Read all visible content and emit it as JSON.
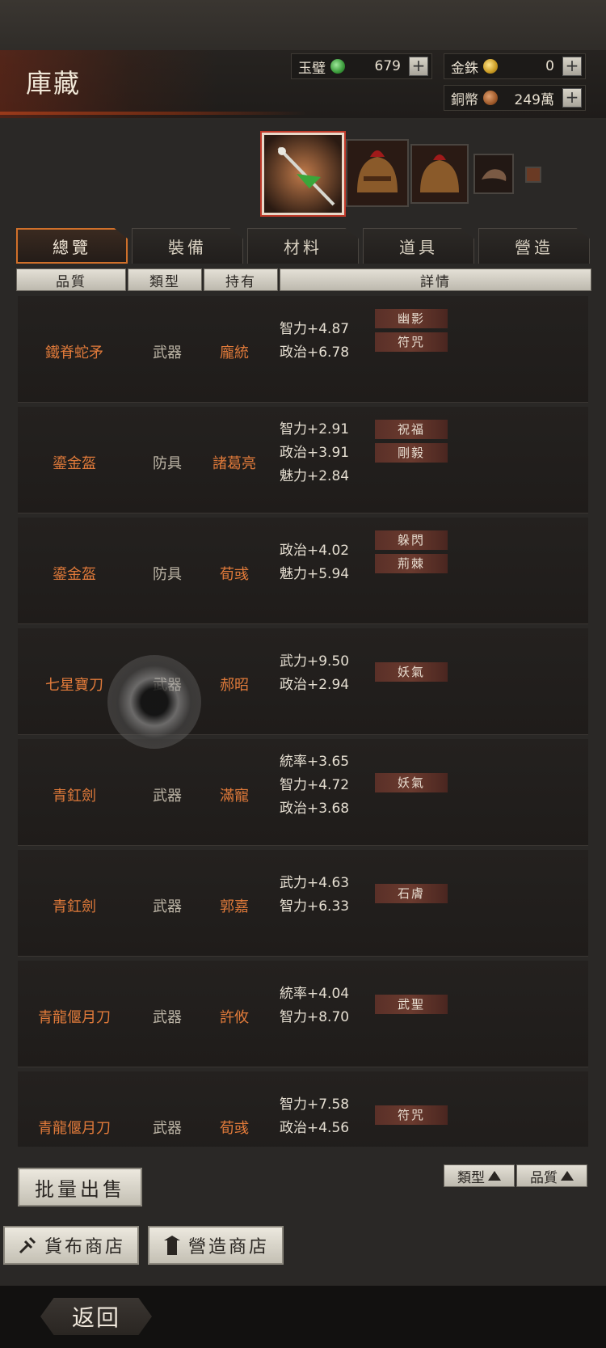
{
  "header": {
    "title": "庫藏"
  },
  "currencies": [
    {
      "name": "玉璧",
      "icon": "jade-coin-icon",
      "value": "679"
    },
    {
      "name": "金銖",
      "icon": "gold-coin-icon",
      "value": "0"
    },
    {
      "name": "銅幣",
      "icon": "copper-coin-icon",
      "value": "249萬"
    }
  ],
  "tabs": [
    {
      "label": "總覽",
      "active": true
    },
    {
      "label": "裝備"
    },
    {
      "label": "材料"
    },
    {
      "label": "道具"
    },
    {
      "label": "營造"
    }
  ],
  "columns": [
    "品質",
    "類型",
    "持有",
    "詳情"
  ],
  "items": [
    {
      "name": "鐵脊蛇矛",
      "type": "武器",
      "owner": "龐統",
      "stats": [
        "智力+4.87",
        "政治+6.78"
      ],
      "traits": [
        "幽影",
        "符咒"
      ]
    },
    {
      "name": "鎏金盔",
      "type": "防具",
      "owner": "諸葛亮",
      "stats": [
        "智力+2.91",
        "政治+3.91",
        "魅力+2.84"
      ],
      "traits": [
        "祝福",
        "剛毅"
      ]
    },
    {
      "name": "鎏金盔",
      "type": "防具",
      "owner": "荀彧",
      "stats": [
        "政治+4.02",
        "魅力+5.94"
      ],
      "traits": [
        "躲閃",
        "荊棘"
      ]
    },
    {
      "name": "七星寶刀",
      "type": "武器",
      "owner": "郝昭",
      "stats": [
        "武力+9.50",
        "政治+2.94"
      ],
      "traits": [
        "妖氣"
      ]
    },
    {
      "name": "青釭劍",
      "type": "武器",
      "owner": "滿寵",
      "stats": [
        "統率+3.65",
        "智力+4.72",
        "政治+3.68"
      ],
      "traits": [
        "妖氣"
      ]
    },
    {
      "name": "青釭劍",
      "type": "武器",
      "owner": "郭嘉",
      "stats": [
        "武力+4.63",
        "智力+6.33"
      ],
      "traits": [
        "石膚"
      ]
    },
    {
      "name": "青龍偃月刀",
      "type": "武器",
      "owner": "許攸",
      "stats": [
        "統率+4.04",
        "智力+8.70"
      ],
      "traits": [
        "武聖"
      ]
    },
    {
      "name": "青龍偃月刀",
      "type": "武器",
      "owner": "荀彧",
      "stats": [
        "智力+7.58",
        "政治+4.56"
      ],
      "traits": [
        "符咒"
      ]
    }
  ],
  "buttons": {
    "bulk_sell": "批量出售",
    "sort_type": "類型",
    "sort_quality": "品質",
    "currency_shop": "貨布商店",
    "build_shop": "營造商店",
    "back": "返回"
  }
}
